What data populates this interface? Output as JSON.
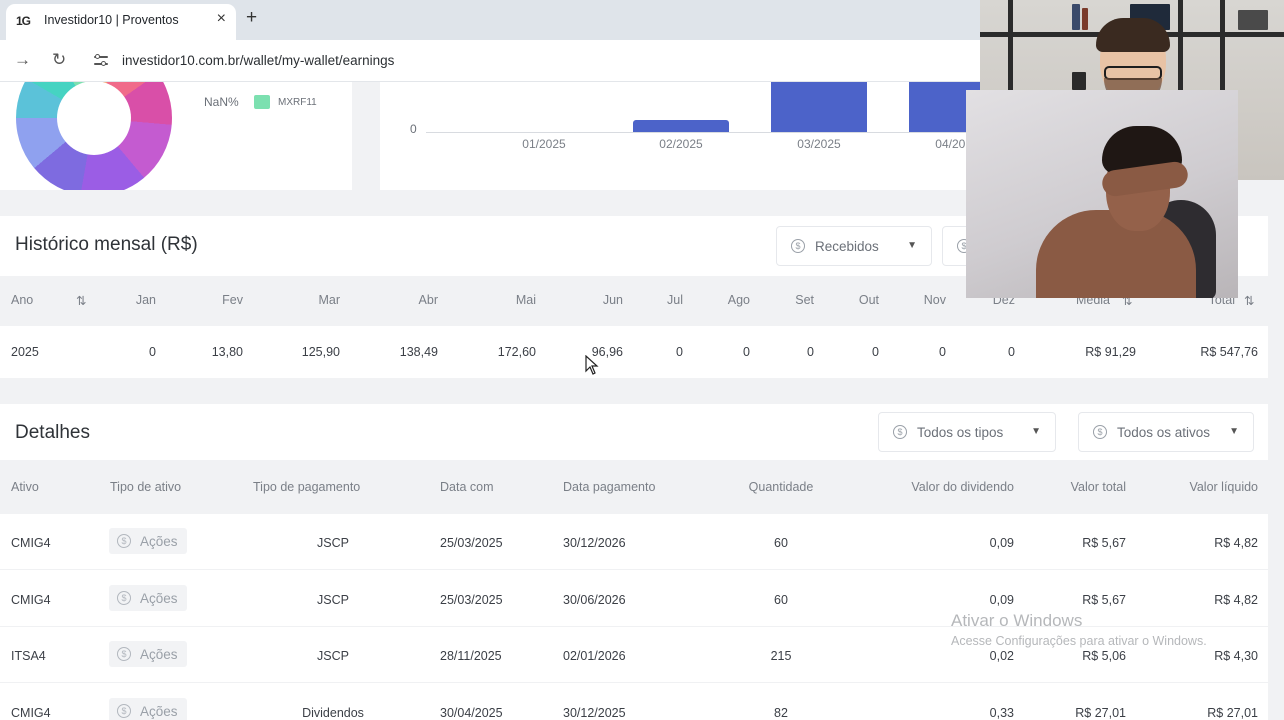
{
  "browser": {
    "tab_favicon": "1G",
    "tab_title": "Investidor10 | Proventos",
    "tab_close": "×",
    "new_tab": "+",
    "url": "investidor10.com.br/wallet/my-wallet/earnings",
    "icons": [
      "forward-arrow-icon",
      "reload-icon",
      "site-settings-icon"
    ]
  },
  "donut_card": {
    "legend": [
      {
        "pct": "NaN%",
        "label": "MXRF11",
        "color": "#7ce0b0"
      }
    ]
  },
  "bar_card": {
    "zero_label": "0"
  },
  "chart_data": {
    "type": "bar",
    "categories": [
      "01/2025",
      "02/2025",
      "03/2025",
      "04/2025"
    ],
    "values": [
      0,
      13.8,
      125.9,
      138.49
    ],
    "color": "#4c63c9"
  },
  "historico": {
    "title": "Histórico mensal (R$)",
    "filter_label": "Recebidos",
    "columns": [
      "Ano",
      "Jan",
      "Fev",
      "Mar",
      "Abr",
      "Mai",
      "Jun",
      "Jul",
      "Ago",
      "Set",
      "Out",
      "Nov",
      "Dez",
      "Média",
      "Total"
    ],
    "row": [
      "2025",
      "0",
      "13,80",
      "125,90",
      "138,49",
      "172,60",
      "96,96",
      "0",
      "0",
      "0",
      "0",
      "0",
      "0",
      "R$ 91,29",
      "R$ 547,76"
    ]
  },
  "detalhes": {
    "title": "Detalhes",
    "filter_tipos": "Todos os tipos",
    "filter_ativos": "Todos os ativos",
    "columns": [
      "Ativo",
      "Tipo de ativo",
      "Tipo de pagamento",
      "Data com",
      "Data pagamento",
      "Quantidade",
      "Valor do dividendo",
      "Valor total",
      "Valor líquido"
    ],
    "rows": [
      {
        "ativo": "CMIG4",
        "tipo": "Ações",
        "pagamento": "JSCP",
        "data_com": "25/03/2025",
        "data_pag": "30/12/2026",
        "qtd": "60",
        "dividendo": "0,09",
        "total": "R$ 5,67",
        "liquido": "R$ 4,82"
      },
      {
        "ativo": "CMIG4",
        "tipo": "Ações",
        "pagamento": "JSCP",
        "data_com": "25/03/2025",
        "data_pag": "30/06/2026",
        "qtd": "60",
        "dividendo": "0,09",
        "total": "R$ 5,67",
        "liquido": "R$ 4,82"
      },
      {
        "ativo": "ITSA4",
        "tipo": "Ações",
        "pagamento": "JSCP",
        "data_com": "28/11/2025",
        "data_pag": "02/01/2026",
        "qtd": "215",
        "dividendo": "0,02",
        "total": "R$ 5,06",
        "liquido": "R$ 4,30"
      },
      {
        "ativo": "CMIG4",
        "tipo": "Ações",
        "pagamento": "Dividendos",
        "data_com": "30/04/2025",
        "data_pag": "30/12/2025",
        "qtd": "82",
        "dividendo": "0,33",
        "total": "R$ 27,01",
        "liquido": "R$ 27,01"
      }
    ]
  },
  "watermark": {
    "line1": "Ativar o Windows",
    "line2": "Acesse Configurações para ativar o Windows."
  }
}
